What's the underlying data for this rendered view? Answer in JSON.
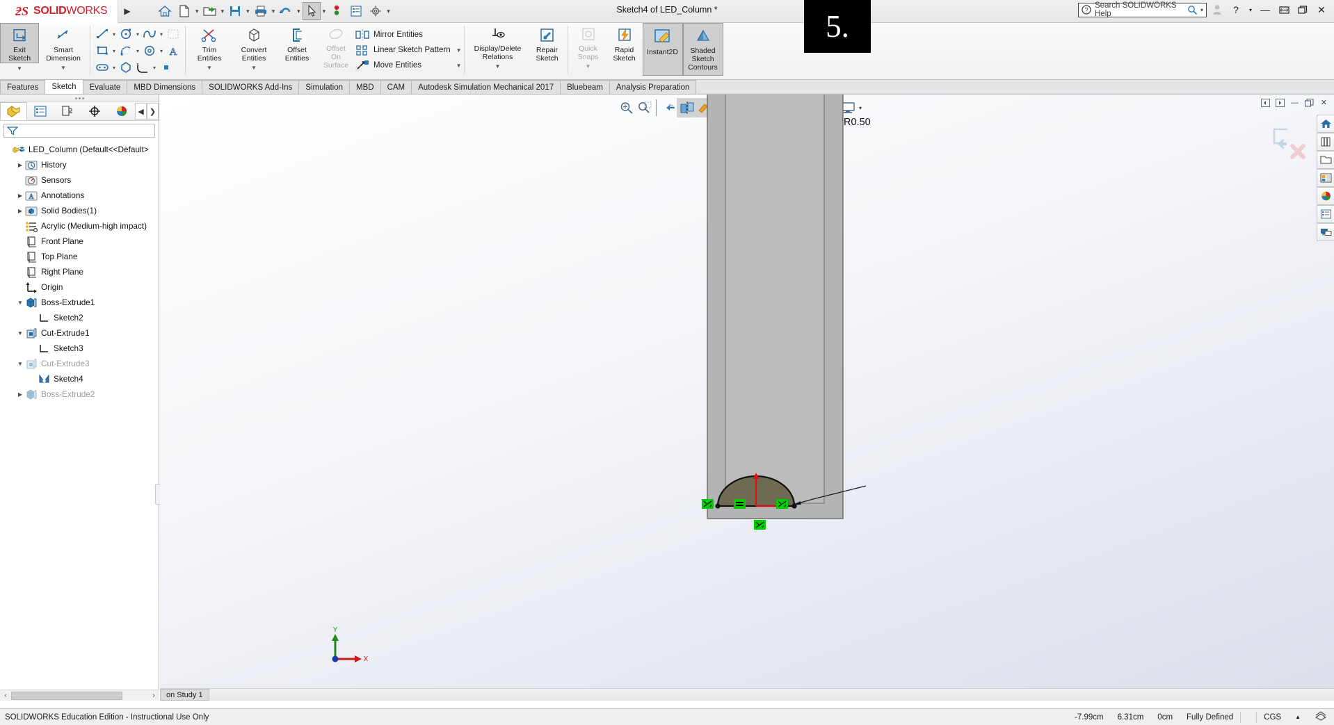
{
  "app": {
    "brand_ds": "2S",
    "brand_solid": "SOLID",
    "brand_works": "WORKS",
    "title": "Sketch4 of LED_Column *",
    "accent_red": "#d21f29",
    "step_badge": "5."
  },
  "titlebar": {
    "menu_arrow": "▶",
    "quick_access": [
      {
        "name": "home-icon",
        "label": "Home"
      },
      {
        "name": "new-document-icon",
        "label": "New"
      },
      {
        "name": "open-document-icon",
        "label": "Open"
      },
      {
        "name": "save-icon",
        "label": "Save"
      },
      {
        "name": "print-icon",
        "label": "Print"
      },
      {
        "name": "undo-icon",
        "label": "Undo"
      },
      {
        "name": "select-cursor-icon",
        "label": "Select"
      },
      {
        "name": "rebuild-icon",
        "label": "Rebuild"
      },
      {
        "name": "options-list-icon",
        "label": "File Properties"
      },
      {
        "name": "gear-icon",
        "label": "Options"
      }
    ],
    "search_placeholder": "Search SOLIDWORKS Help",
    "window_buttons": [
      "minimize",
      "restore",
      "maximize",
      "close"
    ]
  },
  "ribbon": {
    "exit_sketch": "Exit\nSketch",
    "exit_sketch_l1": "Exit",
    "exit_sketch_l2": "Sketch",
    "smart_dimension_l1": "Smart",
    "smart_dimension_l2": "Dimension",
    "trim_l1": "Trim",
    "trim_l2": "Entities",
    "convert_l1": "Convert",
    "convert_l2": "Entities",
    "offset_l1": "Offset",
    "offset_l2": "Entities",
    "offset_surface_l1": "Offset",
    "offset_surface_l2": "On",
    "offset_surface_l3": "Surface",
    "mirror_entities": "Mirror Entities",
    "linear_sketch_pattern": "Linear Sketch Pattern",
    "move_entities": "Move Entities",
    "display_delete_l1": "Display/Delete",
    "display_delete_l2": "Relations",
    "repair_l1": "Repair",
    "repair_l2": "Sketch",
    "quick_snaps_l1": "Quick",
    "quick_snaps_l2": "Snaps",
    "rapid_l1": "Rapid",
    "rapid_l2": "Sketch",
    "instant2d": "Instant2D",
    "shaded_l1": "Shaded",
    "shaded_l2": "Sketch",
    "shaded_l3": "Contours",
    "caret": "▼"
  },
  "tabs": [
    {
      "label": "Features",
      "active": false
    },
    {
      "label": "Sketch",
      "active": true
    },
    {
      "label": "Evaluate",
      "active": false
    },
    {
      "label": "MBD Dimensions",
      "active": false
    },
    {
      "label": "SOLIDWORKS Add-Ins",
      "active": false
    },
    {
      "label": "Simulation",
      "active": false
    },
    {
      "label": "MBD",
      "active": false
    },
    {
      "label": "CAM",
      "active": false
    },
    {
      "label": "Autodesk Simulation Mechanical 2017",
      "active": false
    },
    {
      "label": "Bluebeam",
      "active": false
    },
    {
      "label": "Analysis Preparation",
      "active": false
    }
  ],
  "left_panel": {
    "tabs": [
      {
        "name": "feature-manager-tab",
        "selected": true
      },
      {
        "name": "property-manager-tab",
        "selected": false
      },
      {
        "name": "configuration-manager-tab",
        "selected": false
      },
      {
        "name": "dimxpert-manager-tab",
        "selected": false
      },
      {
        "name": "display-manager-tab",
        "selected": false
      }
    ],
    "nav_prev": "◀",
    "nav_next": "❯",
    "filter_placeholder": "",
    "tree": [
      {
        "label": "LED_Column  (Default<<Default>",
        "icon": "part-icon",
        "indent": 0,
        "arrow": "",
        "dim": false
      },
      {
        "label": "History",
        "icon": "history-icon",
        "indent": 1,
        "arrow": "▶",
        "dim": false
      },
      {
        "label": "Sensors",
        "icon": "sensors-icon",
        "indent": 1,
        "arrow": "",
        "dim": false
      },
      {
        "label": "Annotations",
        "icon": "annotations-icon",
        "indent": 1,
        "arrow": "▶",
        "dim": false
      },
      {
        "label": "Solid Bodies(1)",
        "icon": "solid-bodies-icon",
        "indent": 1,
        "arrow": "▶",
        "dim": false
      },
      {
        "label": "Acrylic (Medium-high impact)",
        "icon": "material-icon",
        "indent": 1,
        "arrow": "",
        "dim": false
      },
      {
        "label": "Front Plane",
        "icon": "plane-icon",
        "indent": 1,
        "arrow": "",
        "dim": false
      },
      {
        "label": "Top Plane",
        "icon": "plane-icon",
        "indent": 1,
        "arrow": "",
        "dim": false
      },
      {
        "label": "Right Plane",
        "icon": "plane-icon",
        "indent": 1,
        "arrow": "",
        "dim": false
      },
      {
        "label": "Origin",
        "icon": "origin-icon",
        "indent": 1,
        "arrow": "",
        "dim": false
      },
      {
        "label": "Boss-Extrude1",
        "icon": "boss-extrude-icon",
        "indent": 1,
        "arrow": "▼",
        "dim": false
      },
      {
        "label": "Sketch2",
        "icon": "sketch-icon",
        "indent": 2,
        "arrow": "",
        "dim": false
      },
      {
        "label": "Cut-Extrude1",
        "icon": "cut-extrude-icon",
        "indent": 1,
        "arrow": "▼",
        "dim": false
      },
      {
        "label": "Sketch3",
        "icon": "sketch-icon",
        "indent": 2,
        "arrow": "",
        "dim": false
      },
      {
        "label": "Cut-Extrude3",
        "icon": "cut-extrude-icon",
        "indent": 1,
        "arrow": "▼",
        "dim": true
      },
      {
        "label": "Sketch4",
        "icon": "sketch-active-icon",
        "indent": 2,
        "arrow": "",
        "dim": false
      },
      {
        "label": "Boss-Extrude2",
        "icon": "boss-extrude-icon",
        "indent": 1,
        "arrow": "▶",
        "dim": true
      }
    ]
  },
  "graphics": {
    "hud_buttons": [
      {
        "name": "zoom-to-fit-icon"
      },
      {
        "name": "zoom-to-area-icon"
      },
      {
        "name": "previous-view-icon"
      },
      {
        "name": "section-view-icon"
      },
      {
        "name": "view-orientation-icon"
      },
      {
        "name": "display-style-icon"
      },
      {
        "name": "hide-show-items-icon"
      },
      {
        "name": "edit-appearance-icon"
      },
      {
        "name": "apply-scene-icon"
      },
      {
        "name": "view-settings-icon"
      }
    ],
    "view_tab_label": "on Study 1",
    "dimension_label": "R0.50",
    "triad_x": "X",
    "triad_y": "Y",
    "window_buttons": [
      "◀",
      "▶",
      "—",
      "❐",
      "✕"
    ]
  },
  "task_pane": [
    {
      "name": "solidworks-resources-icon"
    },
    {
      "name": "design-library-icon"
    },
    {
      "name": "file-explorer-icon"
    },
    {
      "name": "view-palette-icon"
    },
    {
      "name": "appearances-scenes-icon"
    },
    {
      "name": "custom-properties-icon"
    },
    {
      "name": "solidworks-forum-icon"
    }
  ],
  "status_bar": {
    "message": "SOLIDWORKS Education Edition - Instructional Use Only",
    "x_coord": "-7.99cm",
    "y_coord": "6.31cm",
    "z_coord": "0cm",
    "state": "Fully Defined",
    "units": "CGS",
    "units_caret": "▲"
  }
}
